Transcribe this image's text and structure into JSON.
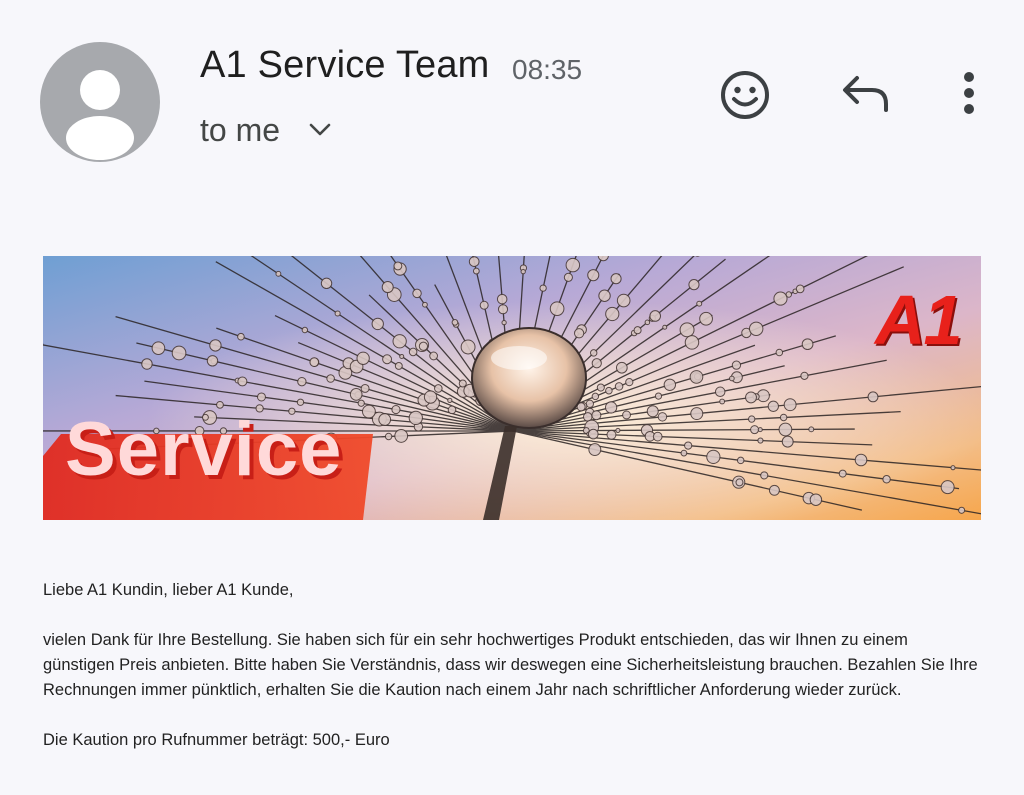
{
  "header": {
    "sender": "A1 Service Team",
    "time": "08:35",
    "recipient": "to me",
    "icons": [
      "avatar-person-icon",
      "chevron-down-icon",
      "emoji-reaction-icon",
      "reply-icon",
      "more-vert-icon"
    ]
  },
  "banner": {
    "headline": "Service",
    "logo_text": "A1",
    "colors": {
      "brand_red": "#e8211b",
      "sky_top": "#7aa6d6",
      "sky_bottom": "#f6b26b"
    }
  },
  "message": {
    "greeting": "Liebe A1 Kundin, lieber A1 Kunde,",
    "paragraph": "vielen Dank für Ihre Bestellung. Sie haben sich für ein sehr hochwertiges Produkt entschieden, das wir Ihnen zu einem günstigen Preis anbieten. Bitte haben Sie Verständnis, dass wir deswegen eine Sicherheitsleistung brauchen. Bezahlen Sie Ihre Rechnungen immer pünktlich, erhalten Sie die Kaution nach einem Jahr nach schriftlicher Anforderung wieder zurück.",
    "deposit_line": "Die Kaution pro Rufnummer beträgt: 500,- Euro"
  }
}
